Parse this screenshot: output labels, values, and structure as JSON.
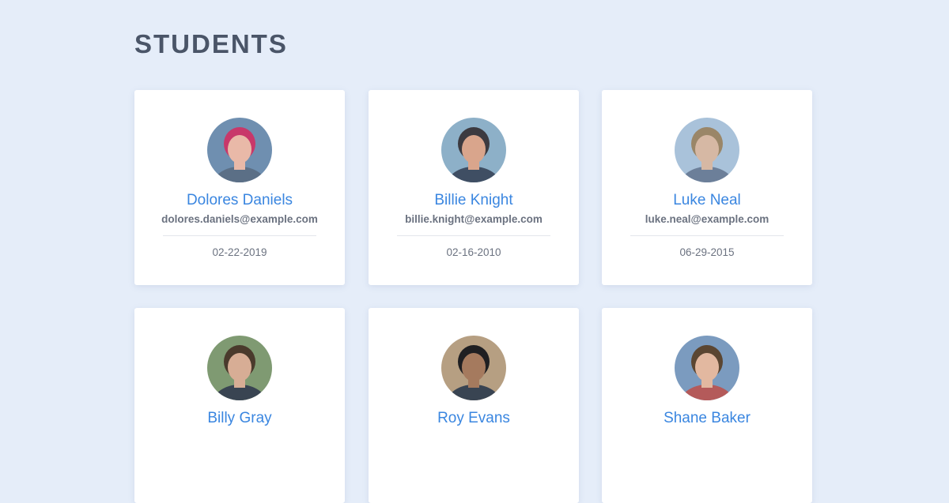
{
  "page": {
    "title": "STUDENTS"
  },
  "students": [
    {
      "name": "Dolores Daniels",
      "email": "dolores.daniels@example.com",
      "date": "02-22-2019",
      "avatar_bg": "#6f8fb0",
      "hair": "#c8386a",
      "skin": "#e9b9a8",
      "shirt": "#5b6f86"
    },
    {
      "name": "Billie Knight",
      "email": "billie.knight@example.com",
      "date": "02-16-2010",
      "avatar_bg": "#8db0c8",
      "hair": "#3c3a40",
      "skin": "#d9a58c",
      "shirt": "#3f4e63"
    },
    {
      "name": "Luke Neal",
      "email": "luke.neal@example.com",
      "date": "06-29-2015",
      "avatar_bg": "#a9c2da",
      "hair": "#9a8668",
      "skin": "#d6b8a4",
      "shirt": "#6c7f99"
    },
    {
      "name": "Billy Gray",
      "email": "",
      "date": "",
      "avatar_bg": "#7f9a72",
      "hair": "#4a3a2c",
      "skin": "#d7ad95",
      "shirt": "#394452"
    },
    {
      "name": "Roy Evans",
      "email": "",
      "date": "",
      "avatar_bg": "#b69f82",
      "hair": "#1f1f22",
      "skin": "#a57a5e",
      "shirt": "#394452"
    },
    {
      "name": "Shane Baker",
      "email": "",
      "date": "",
      "avatar_bg": "#7b9bbf",
      "hair": "#5b4632",
      "skin": "#e2b8a0",
      "shirt": "#b45a5a"
    }
  ]
}
